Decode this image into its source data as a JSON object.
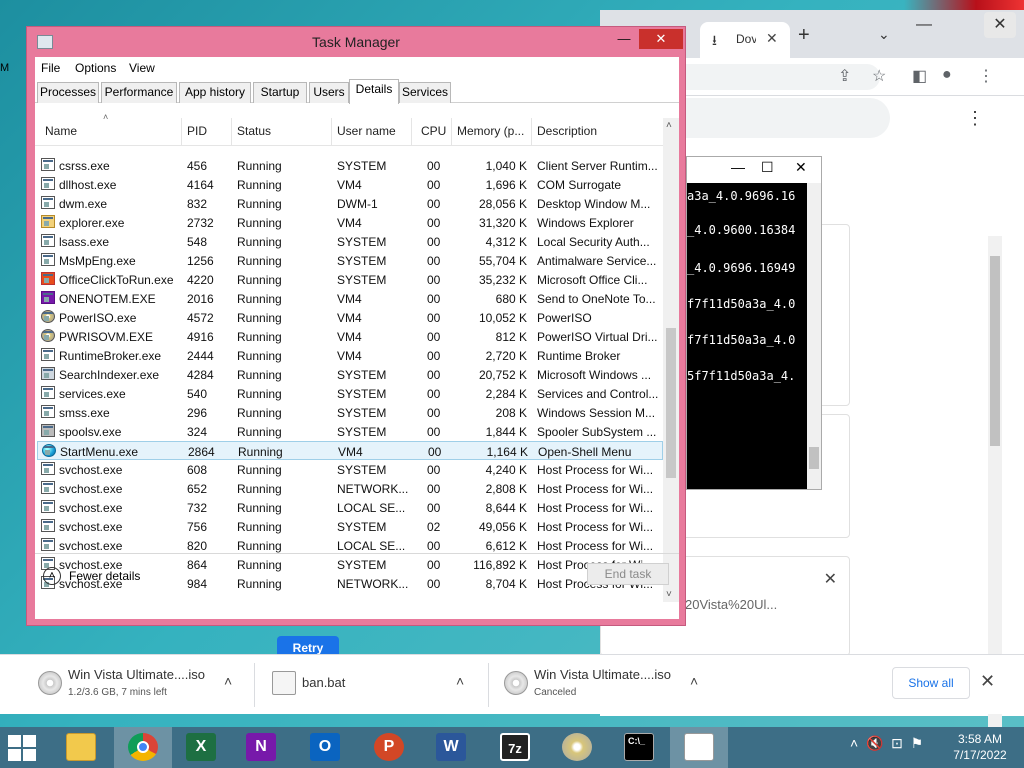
{
  "desktop": {
    "partial_text": "M"
  },
  "chrome": {
    "tab_title": "Dov",
    "console_lines": [
      "a3a_4.0.9696.16",
      "_4.0.9600.16384",
      "_4.0.9696.16949",
      "f7f11d50a3a_4.0",
      "f7f11d50a3a_4.0",
      "5f7f11d50a3a_4."
    ],
    "card_text": "20Vista%20Ul...",
    "retry_label": "Retry"
  },
  "task_manager": {
    "title": "Task Manager",
    "menu": [
      "File",
      "Options",
      "View"
    ],
    "tabs": [
      "Processes",
      "Performance",
      "App history",
      "Startup",
      "Users",
      "Details",
      "Services"
    ],
    "selected_tab": "Details",
    "columns": [
      "Name",
      "PID",
      "Status",
      "User name",
      "CPU",
      "Memory (p...",
      "Description"
    ],
    "rows": [
      {
        "name": "csrss.exe",
        "pid": "456",
        "status": "Running",
        "user": "SYSTEM",
        "cpu": "00",
        "mem": "1,040 K",
        "desc": "Client Server Runtim...",
        "icon": "sys"
      },
      {
        "name": "dllhost.exe",
        "pid": "4164",
        "status": "Running",
        "user": "VM4",
        "cpu": "00",
        "mem": "1,696 K",
        "desc": "COM Surrogate",
        "icon": "sys"
      },
      {
        "name": "dwm.exe",
        "pid": "832",
        "status": "Running",
        "user": "DWM-1",
        "cpu": "00",
        "mem": "28,056 K",
        "desc": "Desktop Window M...",
        "icon": "sys"
      },
      {
        "name": "explorer.exe",
        "pid": "2732",
        "status": "Running",
        "user": "VM4",
        "cpu": "00",
        "mem": "31,320 K",
        "desc": "Windows Explorer",
        "icon": "folder"
      },
      {
        "name": "lsass.exe",
        "pid": "548",
        "status": "Running",
        "user": "SYSTEM",
        "cpu": "00",
        "mem": "4,312 K",
        "desc": "Local Security Auth...",
        "icon": "sys"
      },
      {
        "name": "MsMpEng.exe",
        "pid": "1256",
        "status": "Running",
        "user": "SYSTEM",
        "cpu": "00",
        "mem": "55,704 K",
        "desc": "Antimalware Service...",
        "icon": "sys"
      },
      {
        "name": "OfficeClickToRun.exe",
        "pid": "4220",
        "status": "Running",
        "user": "SYSTEM",
        "cpu": "00",
        "mem": "35,232 K",
        "desc": "Microsoft Office Cli...",
        "icon": "office"
      },
      {
        "name": "ONENOTEM.EXE",
        "pid": "2016",
        "status": "Running",
        "user": "VM4",
        "cpu": "00",
        "mem": "680 K",
        "desc": "Send to OneNote To...",
        "icon": "onenote"
      },
      {
        "name": "PowerISO.exe",
        "pid": "4572",
        "status": "Running",
        "user": "VM4",
        "cpu": "00",
        "mem": "10,052 K",
        "desc": "PowerISO",
        "icon": "disc"
      },
      {
        "name": "PWRISOVM.EXE",
        "pid": "4916",
        "status": "Running",
        "user": "VM4",
        "cpu": "00",
        "mem": "812 K",
        "desc": "PowerISO Virtual Dri...",
        "icon": "disc"
      },
      {
        "name": "RuntimeBroker.exe",
        "pid": "2444",
        "status": "Running",
        "user": "VM4",
        "cpu": "00",
        "mem": "2,720 K",
        "desc": "Runtime Broker",
        "icon": "sys"
      },
      {
        "name": "SearchIndexer.exe",
        "pid": "4284",
        "status": "Running",
        "user": "SYSTEM",
        "cpu": "00",
        "mem": "20,752 K",
        "desc": "Microsoft Windows ...",
        "icon": "search"
      },
      {
        "name": "services.exe",
        "pid": "540",
        "status": "Running",
        "user": "SYSTEM",
        "cpu": "00",
        "mem": "2,284 K",
        "desc": "Services and Control...",
        "icon": "sys"
      },
      {
        "name": "smss.exe",
        "pid": "296",
        "status": "Running",
        "user": "SYSTEM",
        "cpu": "00",
        "mem": "208 K",
        "desc": "Windows Session M...",
        "icon": "sys"
      },
      {
        "name": "spoolsv.exe",
        "pid": "324",
        "status": "Running",
        "user": "SYSTEM",
        "cpu": "00",
        "mem": "1,844 K",
        "desc": "Spooler SubSystem ...",
        "icon": "printer"
      },
      {
        "name": "StartMenu.exe",
        "pid": "2864",
        "status": "Running",
        "user": "VM4",
        "cpu": "00",
        "mem": "1,164 K",
        "desc": "Open-Shell Menu",
        "icon": "globe",
        "selected": true
      },
      {
        "name": "svchost.exe",
        "pid": "608",
        "status": "Running",
        "user": "SYSTEM",
        "cpu": "00",
        "mem": "4,240 K",
        "desc": "Host Process for Wi...",
        "icon": "sys"
      },
      {
        "name": "svchost.exe",
        "pid": "652",
        "status": "Running",
        "user": "NETWORK...",
        "cpu": "00",
        "mem": "2,808 K",
        "desc": "Host Process for Wi...",
        "icon": "sys"
      },
      {
        "name": "svchost.exe",
        "pid": "732",
        "status": "Running",
        "user": "LOCAL SE...",
        "cpu": "00",
        "mem": "8,644 K",
        "desc": "Host Process for Wi...",
        "icon": "sys"
      },
      {
        "name": "svchost.exe",
        "pid": "756",
        "status": "Running",
        "user": "SYSTEM",
        "cpu": "02",
        "mem": "49,056 K",
        "desc": "Host Process for Wi...",
        "icon": "sys"
      },
      {
        "name": "svchost.exe",
        "pid": "820",
        "status": "Running",
        "user": "LOCAL SE...",
        "cpu": "00",
        "mem": "6,612 K",
        "desc": "Host Process for Wi...",
        "icon": "sys"
      },
      {
        "name": "svchost.exe",
        "pid": "864",
        "status": "Running",
        "user": "SYSTEM",
        "cpu": "00",
        "mem": "116,892 K",
        "desc": "Host Process for Wi...",
        "icon": "sys"
      },
      {
        "name": "svchost.exe",
        "pid": "984",
        "status": "Running",
        "user": "NETWORK...",
        "cpu": "00",
        "mem": "8,704 K",
        "desc": "Host Process for Wi...",
        "icon": "sys"
      }
    ],
    "fewer_details": "Fewer details",
    "end_task": "End task"
  },
  "downloads": [
    {
      "name": "Win Vista Ultimate....iso",
      "sub": "1.2/3.6 GB, 7 mins left"
    },
    {
      "name": "ban.bat",
      "sub": ""
    },
    {
      "name": "Win Vista Ultimate....iso",
      "sub": "Canceled"
    }
  ],
  "downloads_bar": {
    "show_all": "Show all"
  },
  "taskbar": {
    "apps": [
      "file-explorer",
      "chrome",
      "excel",
      "onenote",
      "outlook",
      "powerpoint",
      "word",
      "7zip",
      "poweriso",
      "cmd",
      "notepad"
    ],
    "letters": {
      "excel": "X",
      "onenote": "N",
      "outlook": "O",
      "powerpoint": "P",
      "word": "W",
      "7zip": "7z"
    },
    "time": "3:58 AM",
    "date": "7/17/2022"
  }
}
